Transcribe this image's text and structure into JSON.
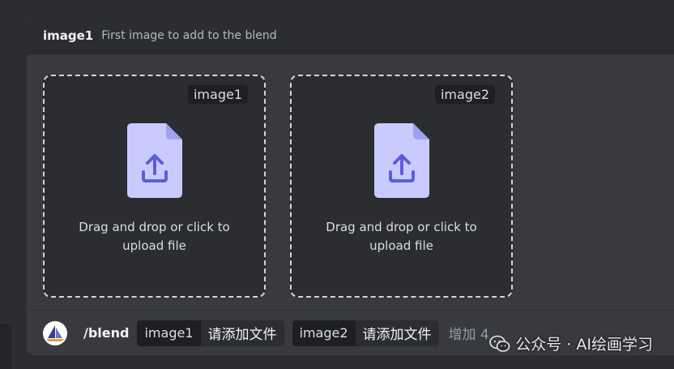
{
  "option_header": {
    "param_name": "image1",
    "param_description": "First image to add to the blend"
  },
  "upload_slots": [
    {
      "tag": "image1",
      "line1": "Drag and drop or click to",
      "line2": "upload file",
      "icon": "upload-file-icon"
    },
    {
      "tag": "image2",
      "line1": "Drag and drop or click to",
      "line2": "upload file",
      "icon": "upload-file-icon"
    }
  ],
  "command_bar": {
    "command": "/blend",
    "options": [
      {
        "key": "image1",
        "value": "请添加文件"
      },
      {
        "key": "image2",
        "value": "请添加文件"
      }
    ],
    "more_label": "增加 4"
  },
  "watermark": {
    "text": "公众号 · AI绘画学习"
  },
  "colors": {
    "panel_bg": "#383a40",
    "header_bg": "#2b2d31",
    "file_icon": "#c9cbff",
    "file_icon_fold": "#9ea1f0",
    "upload_arrow": "#5b5fd6"
  }
}
